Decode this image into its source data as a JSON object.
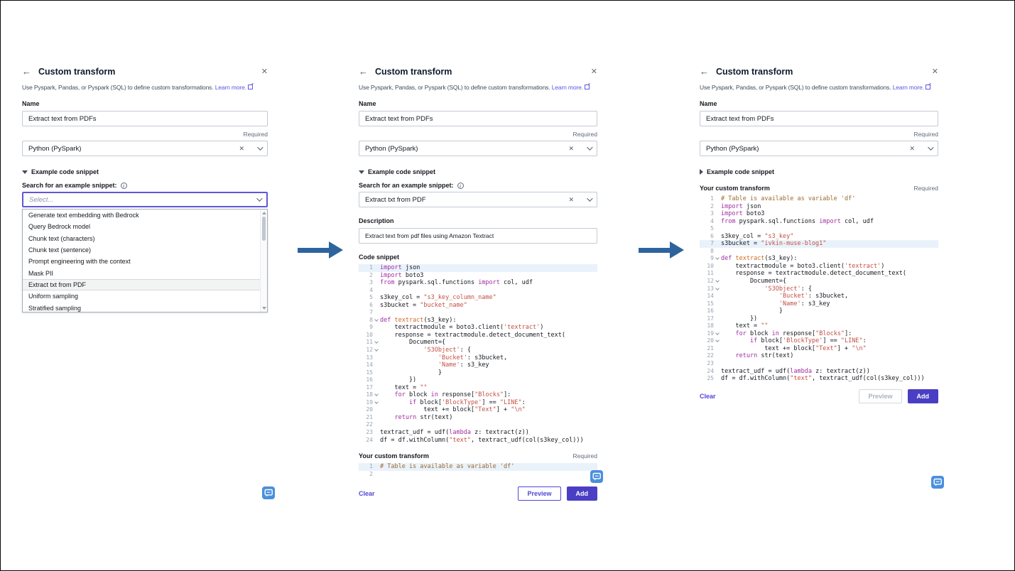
{
  "shared": {
    "title": "Custom transform",
    "back_icon": "←",
    "close_icon": "✕",
    "clear_icon": "✕",
    "intro": "Use Pyspark, Pandas, or Pyspark (SQL) to define custom transformations.",
    "learn_more": "Learn more.",
    "name_label": "Name",
    "name_value": "Extract text from PDFs",
    "required": "Required",
    "language_value": "Python (PySpark)",
    "expander_label": "Example code snippet",
    "search_label": "Search for an example snippet:",
    "info_icon": "i",
    "description_label": "Description",
    "code_snippet_label": "Code snippet",
    "custom_transform_label": "Your custom transform",
    "clear": "Clear",
    "preview": "Preview",
    "add": "Add"
  },
  "colors": {
    "accent_button": "#4a3fc4",
    "link_purple": "#6156e0",
    "arrow_blue": "#2e649e",
    "chat_blue": "#4a8fdd",
    "active_line": "#e9f2fb"
  },
  "panel1": {
    "select_placeholder": "Select...",
    "dropdown": {
      "highlighted_index": 6,
      "options": [
        "Generate text embedding with Bedrock",
        "Query Bedrock model",
        "Chunk text (characters)",
        "Chunk text (sentence)",
        "Prompt engineering with the context",
        "Mask PII",
        "Extract txt from PDF",
        "Uniform sampling",
        "Stratified sampling"
      ]
    }
  },
  "panel2": {
    "snippet_value": "Extract txt from PDF",
    "description_value": "Extract text from pdf files using Amazon Textract",
    "code_snippet": {
      "active": [
        1
      ],
      "folds": [
        8,
        11,
        12,
        18,
        19
      ],
      "lines": [
        "import json",
        "import boto3",
        "from pyspark.sql.functions import col, udf",
        "",
        "s3key_col = \"s3_key_column_name\"",
        "s3bucket = \"bucket_name\"",
        "",
        "def textract(s3_key):",
        "    textractmodule = boto3.client('textract')",
        "    response = textractmodule.detect_document_text(",
        "        Document={",
        "            'S3Object': {",
        "                'Bucket': s3bucket,",
        "                'Name': s3_key",
        "                }",
        "        })",
        "    text = \"\"",
        "    for block in response[\"Blocks\"]:",
        "        if block['BlockType'] == \"LINE\":",
        "            text += block[\"Text\"] + \"\\n\"",
        "    return str(text)",
        "",
        "textract_udf = udf(lambda z: textract(z))",
        "df = df.withColumn(\"text\", textract_udf(col(s3key_col)))"
      ]
    },
    "custom": {
      "active": [
        1
      ],
      "folds": [],
      "lines": [
        "# Table is available as variable 'df'",
        ""
      ]
    }
  },
  "panel3": {
    "code": {
      "active": [
        7
      ],
      "folds": [
        9,
        12,
        13,
        19,
        20
      ],
      "lines": [
        "# Table is available as variable 'df'",
        "import json",
        "import boto3",
        "from pyspark.sql.functions import col, udf",
        "",
        "s3key_col = \"s3_key\"",
        "s3bucket = \"ivkin-muse-blog1\"",
        "",
        "def textract(s3_key):",
        "    textractmodule = boto3.client('textract')",
        "    response = textractmodule.detect_document_text(",
        "        Document={",
        "            'S3Object': {",
        "                'Bucket': s3bucket,",
        "                'Name': s3_key",
        "                }",
        "        })",
        "    text = \"\"",
        "    for block in response[\"Blocks\"]:",
        "        if block['BlockType'] == \"LINE\":",
        "            text += block[\"Text\"] + \"\\n\"",
        "    return str(text)",
        "",
        "textract_udf = udf(lambda z: textract(z))",
        "df = df.withColumn(\"text\", textract_udf(col(s3key_col)))"
      ]
    }
  }
}
